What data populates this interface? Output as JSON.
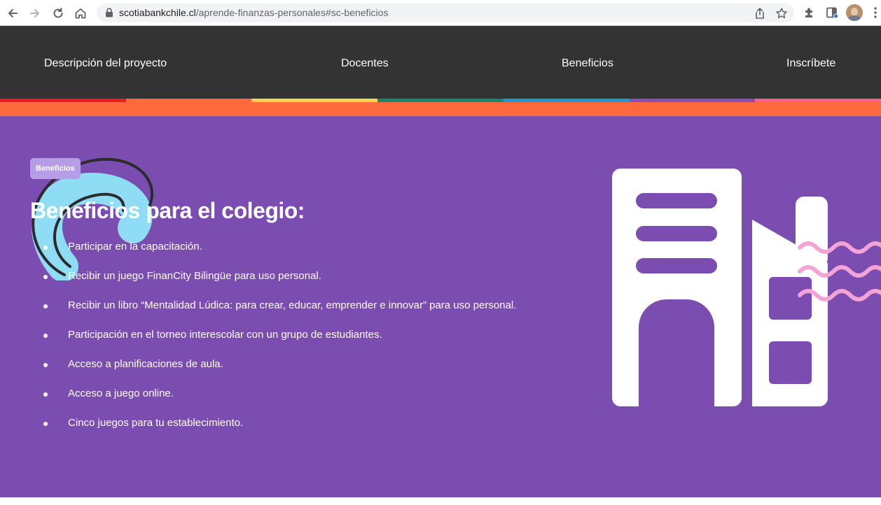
{
  "browser": {
    "url_host": "scotiabankchile.cl",
    "url_path": "/aprende-finanzas-personales#sc-beneficios"
  },
  "site_nav": {
    "items": [
      {
        "label": "Descripción del proyecto"
      },
      {
        "label": "Docentes"
      },
      {
        "label": "Beneficios"
      },
      {
        "label": "Inscríbete"
      }
    ],
    "stripe_colors": [
      "#ec1c24",
      "#ff6a3c",
      "#ffd54f",
      "#0f8b6f",
      "#1e9bd7",
      "#8e4bb5",
      "#ff5f8f"
    ]
  },
  "section": {
    "badge": "Beneficios",
    "title": "Beneficios para el colegio:",
    "items": [
      "Participar en la capacitación.",
      "Recibir un juego FinanCity Bilingüe para uso personal.",
      "Recibir un libro “Mentalidad Lúdica: para crear, educar, emprender e innovar” para uso personal.",
      "Participación en el torneo interescolar con un grupo de estudiantes.",
      "Acceso a planificaciones de aula.",
      "Acceso a juego online.",
      "Cinco juegos para tu establecimiento."
    ]
  },
  "colors": {
    "nav_bg": "#333333",
    "section_bg": "#7b4db1",
    "badge_bg": "#b79de6",
    "accent_orange": "#ff6a3c",
    "deco_blue": "#8fdcf5",
    "wave_pink": "#f4a3d6"
  },
  "icons": [
    "back-arrow-icon",
    "forward-arrow-icon",
    "reload-icon",
    "home-icon",
    "lock-icon",
    "share-icon",
    "star-icon",
    "extensions-icon",
    "reading-list-icon",
    "menu-dots-icon",
    "building-illustration"
  ]
}
